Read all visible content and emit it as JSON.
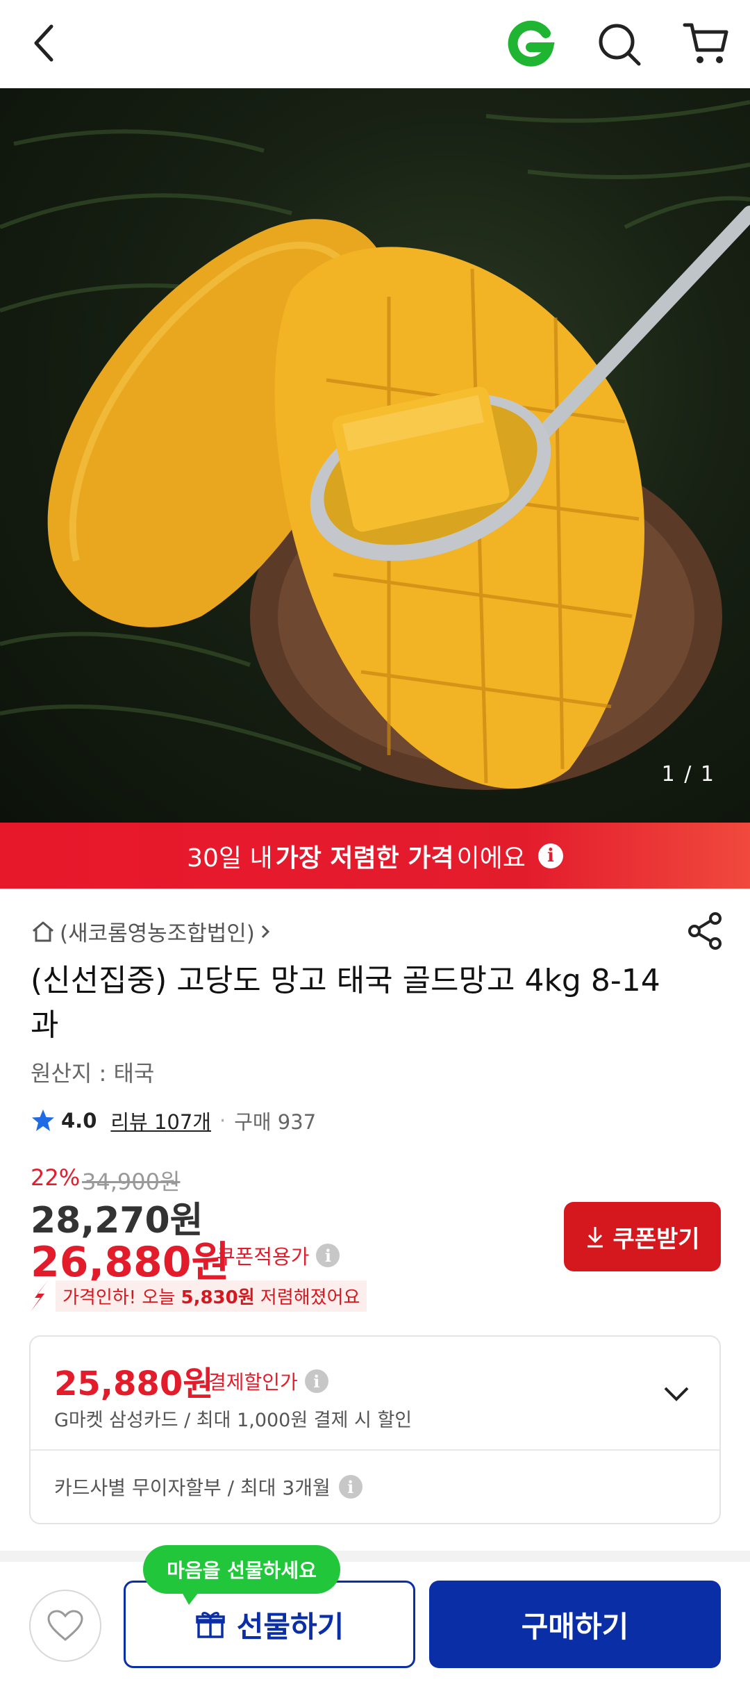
{
  "hero": {
    "counter": "1 / 1"
  },
  "banner": {
    "prefix": "30일 내 ",
    "bold": "가장 저렴한 가격",
    "suffix": "이에요",
    "info": "i"
  },
  "product": {
    "seller": "(새코롬영농조합법인)",
    "title": "(신선집중) 고당도 망고 태국 골드망고 4kg 8-14과",
    "origin": "원산지 : 태국",
    "rating": "4.0",
    "review": "리뷰 107개",
    "separator": "·",
    "purchases": "구매 937"
  },
  "price": {
    "discount_pct": "22%",
    "original": "34,900원",
    "sale": "28,270원",
    "coupon_price": "26,880원",
    "coupon_label": "쿠폰적용가",
    "coupon_button": "쿠폰받기",
    "drop_prefix": "가격인하! 오늘 ",
    "drop_amount": "5,830원",
    "drop_suffix": " 저렴해졌어요"
  },
  "card": {
    "pay_price": "25,880원",
    "pay_label": "결제할인가",
    "pay_sub": "G마켓 삼성카드 / 최대 1,000원 결제 시 할인",
    "installment": "카드사별 무이자할부 / 최대 3개월"
  },
  "bottom": {
    "tooltip": "마음을 선물하세요",
    "gift": "선물하기",
    "buy": "구매하기"
  },
  "colors": {
    "red": "#e31c2c",
    "navy": "#0a2ea6",
    "green": "#21c63b"
  }
}
